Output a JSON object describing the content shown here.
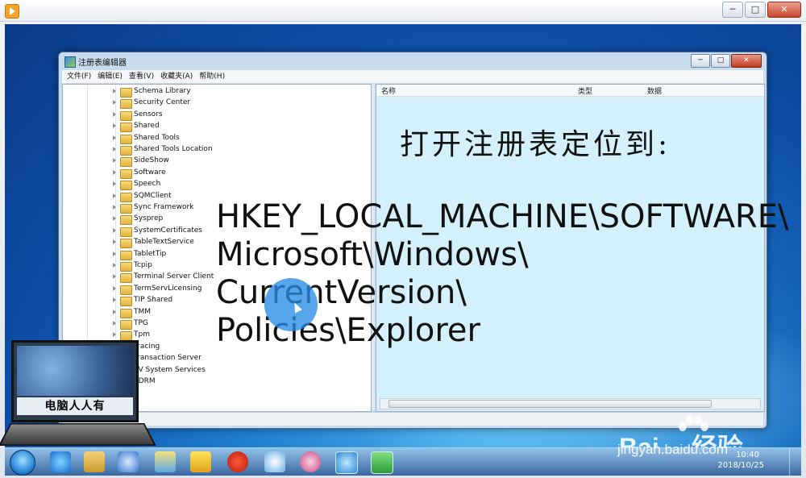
{
  "regedit": {
    "title": "注册表编辑器",
    "menu": [
      "文件(F)",
      "编辑(E)",
      "查看(V)",
      "收藏夹(A)",
      "帮助(H)"
    ],
    "tree_items": [
      "Schema Library",
      "Security Center",
      "Sensors",
      "Shared",
      "Shared Tools",
      "Shared Tools Location",
      "SideShow",
      "Software",
      "Speech",
      "SQMClient",
      "Sync Framework",
      "Sysprep",
      "SystemCertificates",
      "TableTextService",
      "TabletTip",
      "Tcpip",
      "Terminal Server Client",
      "TermServLicensing",
      "TIP Shared",
      "TMM",
      "TPG",
      "Tpm",
      "Tracing",
      "Transaction Server",
      "TV System Services",
      "uDRM"
    ],
    "columns": {
      "name": "名称",
      "type": "类型",
      "data": "数据"
    }
  },
  "overlay": {
    "heading": "打开注册表定位到:",
    "path_lines": [
      "HKEY_LOCAL_MACHINE\\SOFTWARE\\",
      "Microsoft\\Windows\\",
      "CurrentVersion\\",
      "Policies\\Explorer"
    ]
  },
  "logo": {
    "text": "电脑人人有"
  },
  "watermark": {
    "brand": "Bai",
    "brand_suffix": "经验",
    "url": "jingyan.baidu.com"
  },
  "taskbar": {
    "time": "10:40",
    "date": "2018/10/25"
  },
  "colors": {
    "list_bg": "#d4f0fb",
    "desktop": "#1f7fd0",
    "cursor_highlight": "#288ce6"
  }
}
